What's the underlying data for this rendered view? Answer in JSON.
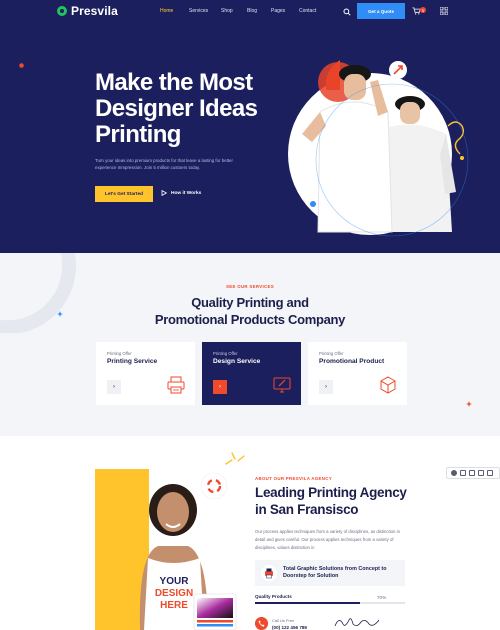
{
  "brand": {
    "name": "Presvila"
  },
  "nav": {
    "items": [
      "Home",
      "Services",
      "Shop",
      "Blog",
      "Pages",
      "Contact"
    ],
    "active": "Home",
    "quote_button": "Get a Quote",
    "cart_count": "0",
    "icons": [
      "search-icon",
      "cart-icon",
      "grid-menu-icon"
    ]
  },
  "hero": {
    "title_lines": [
      "Make the Most",
      "Designer Ideas",
      "Printing"
    ],
    "description": "Turn your ideas into premium products for that leave a lasting for better experience Inmpression. Join 5 million custoers today.",
    "primary_button": "Let's Get Started",
    "secondary_link": "How it Works"
  },
  "services": {
    "eyebrow": "SEE OUR SERVICES",
    "title_lines": [
      "Quality Printing and",
      "Promotional Products Company"
    ],
    "cards": [
      {
        "small": "Printing Offer",
        "name": "Printing Service",
        "icon": "printer-icon",
        "active": false
      },
      {
        "small": "Printing Offer",
        "name": "Design Service",
        "icon": "monitor-design-icon",
        "active": true
      },
      {
        "small": "Printing Offer",
        "name": "Promotional Product",
        "icon": "package-icon",
        "active": false
      }
    ]
  },
  "about": {
    "eyebrow": "ABOUT OUR PRESVILA AGENCY",
    "title_lines": [
      "Leading Printing Agency",
      "in San Fransisco"
    ],
    "description": "Our process applies techniques from a variety of disciplines, as distinction in detail and gives careful. Our process applies techniques from a variety of disciplines, values distinction in",
    "feature": "Total Graphic Solutions from Concept to Doorstep for Solution",
    "progress_label": "Quality Products",
    "progress_value": "70%",
    "progress_fraction": 0.7,
    "call_label": "Call Us Free",
    "call_number": "(00) 122 456 789",
    "shirt_text": [
      "YOUR",
      "DESIGN",
      "HERE"
    ]
  },
  "colors": {
    "navy": "#1c1f5e",
    "yellow": "#ffc42c",
    "accent_red": "#ef4a2b",
    "blue_button": "#2f8df5",
    "nav_active": "#ffcc2f"
  }
}
